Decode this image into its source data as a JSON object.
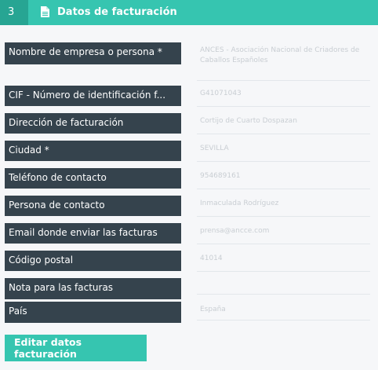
{
  "header": {
    "step_number": "3",
    "title": "Datos de facturación",
    "icon": "document-icon"
  },
  "fields": [
    {
      "label": "Nombre de empresa o persona *",
      "value": "ANCES - Asociación Nacional de Criadores de Caballos Españoles"
    },
    {
      "label": "CIF - Número de identificación f...",
      "value": "G41071043"
    },
    {
      "label": "Dirección de facturación",
      "value": "Cortijo de Cuarto Dospazan"
    },
    {
      "label": "Ciudad *",
      "value": "SEVILLA"
    },
    {
      "label": "Teléfono de contacto",
      "value": "954689161"
    },
    {
      "label": "Persona de contacto",
      "value": "Inmaculada Rodríguez"
    },
    {
      "label": "Email donde enviar las facturas",
      "value": "prensa@ancce.com"
    },
    {
      "label": "Código postal",
      "value": "41014"
    },
    {
      "label": "Nota para las facturas",
      "value": ""
    },
    {
      "label": "País",
      "value": "España"
    }
  ],
  "actions": {
    "edit_billing_label": "Editar datos facturación"
  },
  "colors": {
    "accent": "#36c5b0",
    "accent_dark": "#27a593",
    "label_bg": "#35434d",
    "page_bg": "#f6f7f9"
  }
}
